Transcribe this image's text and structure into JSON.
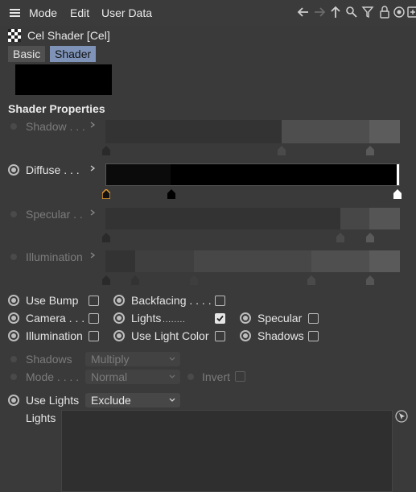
{
  "menu": {
    "items": [
      "Mode",
      "Edit",
      "User Data"
    ]
  },
  "header": {
    "title": "Cel Shader [Cel]",
    "tabs": [
      {
        "label": "Basic",
        "active": false
      },
      {
        "label": "Shader",
        "active": true
      }
    ]
  },
  "section": {
    "title": "Shader Properties"
  },
  "gradients": {
    "shadow": {
      "label": "Shadow",
      "dots": " . . .",
      "enabled": false
    },
    "diffuse": {
      "label": "Diffuse",
      "dots": " . . .",
      "enabled": true
    },
    "specular": {
      "label": "Specular",
      "dots": " . .",
      "enabled": false
    },
    "illumination": {
      "label": "Illumination",
      "dots": "",
      "enabled": false
    }
  },
  "options": {
    "use_bump": {
      "label": "Use Bump",
      "checked": false
    },
    "backfacing": {
      "label": "Backfacing",
      "dots": " . . . .",
      "checked": false
    },
    "camera": {
      "label": "Camera",
      "dots": " . . .",
      "checked": false
    },
    "lights": {
      "label": "Lights",
      "dots": " . . . . . . . .",
      "checked": true
    },
    "specular": {
      "label": "Specular",
      "checked": false
    },
    "illumination": {
      "label": "Illumination",
      "checked": false
    },
    "use_light_color": {
      "label": "Use Light Color",
      "checked": false
    },
    "shadows": {
      "label": "Shadows",
      "checked": false
    }
  },
  "shadows_mode": {
    "label": "Shadows",
    "value": "Multiply"
  },
  "mode": {
    "label": "Mode",
    "dots": " . . . .",
    "value": "Normal"
  },
  "invert": {
    "label": "Invert",
    "checked": false
  },
  "use_lights": {
    "label": "Use Lights",
    "value": "Exclude"
  },
  "lights_list": {
    "label": "Lights",
    "items": []
  },
  "colors": {
    "tab_active": "#7f93b8",
    "background": "#3a3a3a"
  }
}
